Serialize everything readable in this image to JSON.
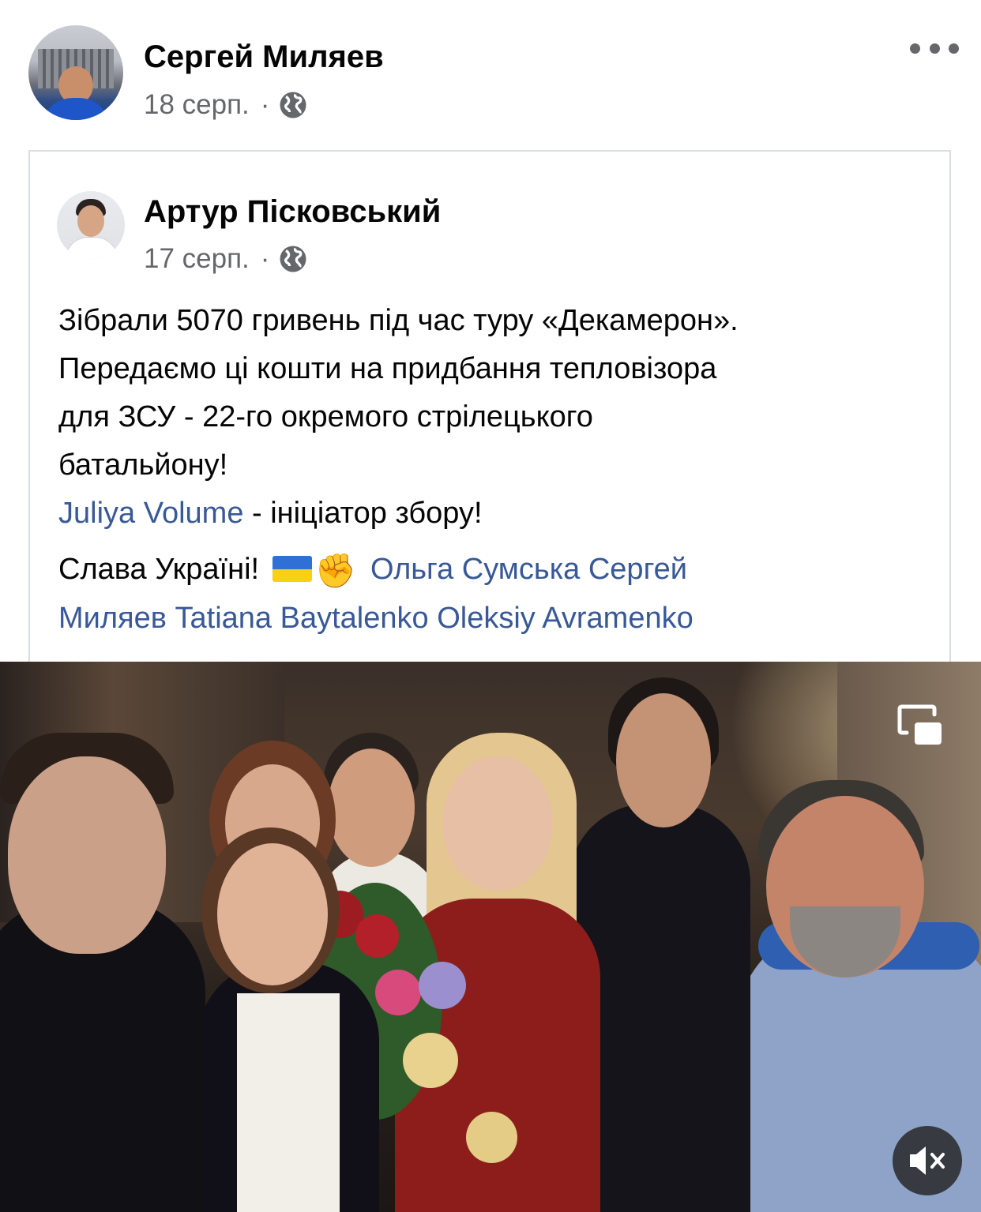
{
  "post": {
    "author": "Сергей Миляев",
    "date": "18 серп.",
    "separator": "·",
    "audience_icon": "globe-icon",
    "more_icon": "more-options-icon"
  },
  "shared_post": {
    "author": "Артур Пісковський",
    "date": "17 серп.",
    "separator": "·",
    "audience_icon": "globe-icon",
    "lines": [
      "Зібрали 5070 гривень під час туру  «Декамерон».",
      "Передаємо ці кошти на придбання тепловізора",
      "для ЗСУ - 22-го окремого стрілецького",
      "батальйону!"
    ],
    "initiator_link": "Juliya Volume",
    "initiator_text": " - ініціатор збору!",
    "slogan": "Слава Україні!",
    "fist_emoji": "✊",
    "tags": [
      "Ольга Сумська",
      "Сергей Миляев",
      "Tatiana Baytalenko",
      "Oleksiy Avramenko"
    ]
  },
  "video": {
    "pip_icon": "picture-in-picture-icon",
    "mute_icon": "muted-speaker-icon"
  },
  "colors": {
    "text": "#050505",
    "secondary": "#65676b",
    "link": "#385898",
    "border": "#dadde1"
  }
}
